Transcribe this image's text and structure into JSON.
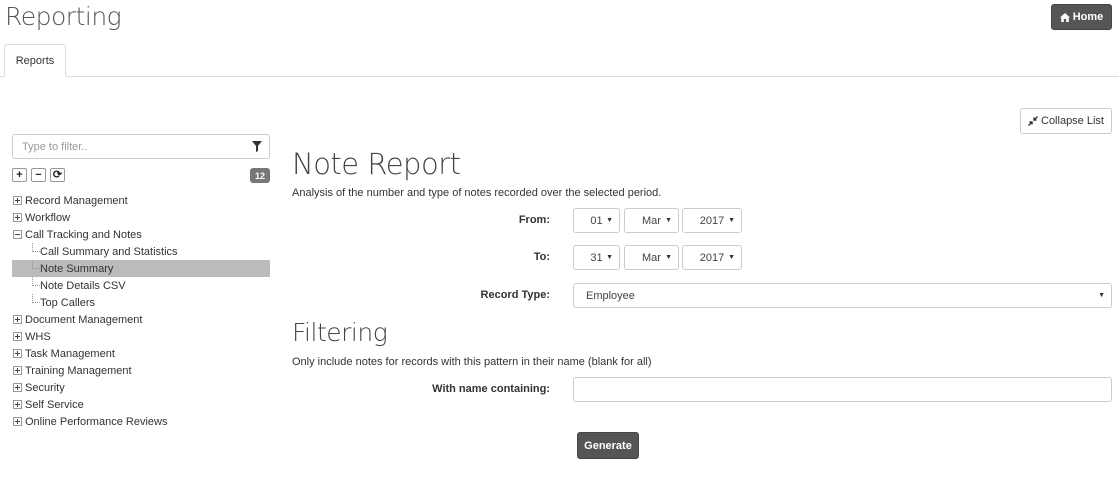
{
  "header": {
    "title": "Reporting",
    "home_label": "Home",
    "home_icon": "home-icon"
  },
  "tabs": [
    {
      "label": "Reports",
      "active": true
    }
  ],
  "toolbar": {
    "collapse_label": "Collapse List",
    "collapse_icon": "compress-icon"
  },
  "sidebar": {
    "filter_placeholder": "Type to filter..",
    "filter_icon": "funnel-icon",
    "tools": [
      "+",
      "−",
      "⟳"
    ],
    "count": "12",
    "items": [
      {
        "label": "Record Management",
        "expanded": false
      },
      {
        "label": "Workflow",
        "expanded": false
      },
      {
        "label": "Call Tracking and Notes",
        "expanded": true,
        "children": [
          {
            "label": "Call Summary and Statistics"
          },
          {
            "label": "Note Summary",
            "selected": true
          },
          {
            "label": "Note Details CSV"
          },
          {
            "label": "Top Callers"
          }
        ]
      },
      {
        "label": "Document Management",
        "expanded": false
      },
      {
        "label": "WHS",
        "expanded": false
      },
      {
        "label": "Task Management",
        "expanded": false
      },
      {
        "label": "Training Management",
        "expanded": false
      },
      {
        "label": "Security",
        "expanded": false
      },
      {
        "label": "Self Service",
        "expanded": false
      },
      {
        "label": "Online Performance Reviews",
        "expanded": false
      }
    ]
  },
  "report": {
    "title": "Note Report",
    "description": "Analysis of the number and type of notes recorded over the selected period.",
    "from_label": "From:",
    "from": {
      "day": "01",
      "month": "Mar",
      "year": "2017"
    },
    "to_label": "To:",
    "to": {
      "day": "31",
      "month": "Mar",
      "year": "2017"
    },
    "record_type_label": "Record Type:",
    "record_type": "Employee"
  },
  "filtering": {
    "title": "Filtering",
    "description": "Only include notes for records with this pattern in their name (blank for all)",
    "name_label": "With name containing:",
    "name_value": ""
  },
  "actions": {
    "generate_label": "Generate"
  },
  "colors": {
    "dark_button": "#555555",
    "selected_row": "#bbbbbb",
    "badge": "#777777"
  }
}
